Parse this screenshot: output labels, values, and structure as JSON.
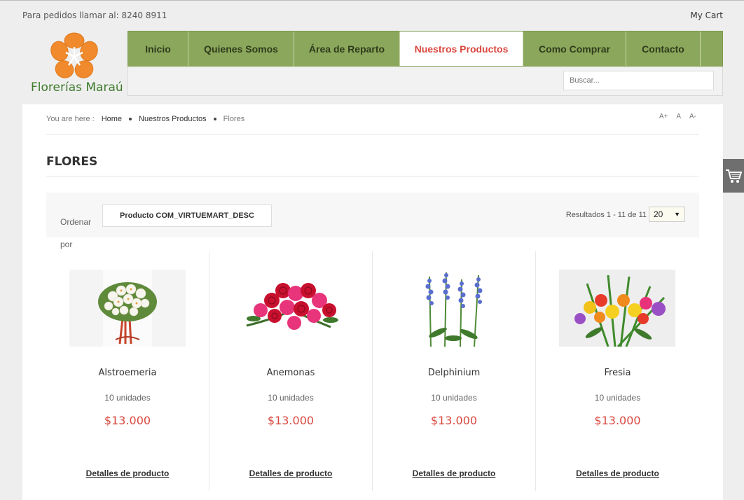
{
  "topbar": {
    "phone_text": "Para pedidos llamar al: 8240 8911",
    "cart_label": "My Cart"
  },
  "logo": {
    "brand_name": "Florerías Maraú",
    "petal_color": "#f08a2c",
    "text_color": "#3e7a2b"
  },
  "nav": {
    "items": [
      {
        "label": "Inicio",
        "active": false
      },
      {
        "label": "Quienes Somos",
        "active": false
      },
      {
        "label": "Área de Reparto",
        "active": false
      },
      {
        "label": "Nuestros Productos",
        "active": true
      },
      {
        "label": "Como Comprar",
        "active": false
      },
      {
        "label": "Contacto",
        "active": false
      }
    ],
    "background_color": "#8ba75b",
    "active_color": "#d9473f"
  },
  "search": {
    "placeholder": "Buscar..."
  },
  "breadcrumb": {
    "prefix": "You are here :",
    "items": [
      "Home",
      "Nuestros Productos",
      "Flores"
    ]
  },
  "font_controls": [
    "A+",
    "A",
    "A-"
  ],
  "page": {
    "title": "FLORES"
  },
  "ordering": {
    "label": "Ordenar por",
    "selected": "Producto COM_VIRTUEMART_DESC",
    "results_text": "Resultados 1 - 11 de 11",
    "limit_value": "20"
  },
  "products": [
    {
      "name": "Alstroemeria",
      "units": "10 unidades",
      "price": "$13.000",
      "link": "Detalles de producto",
      "image": "white-bouquet"
    },
    {
      "name": "Anemonas",
      "units": "10 unidades",
      "price": "$13.000",
      "link": "Detalles de producto",
      "image": "red-pink-roses"
    },
    {
      "name": "Delphinium",
      "units": "10 unidades",
      "price": "$13.000",
      "link": "Detalles de producto",
      "image": "blue-delphinium"
    },
    {
      "name": "Fresia",
      "units": "10 unidades",
      "price": "$13.000",
      "link": "Detalles de producto",
      "image": "colorful-freesia"
    }
  ],
  "side_cart": {
    "icon": "cart-icon"
  }
}
